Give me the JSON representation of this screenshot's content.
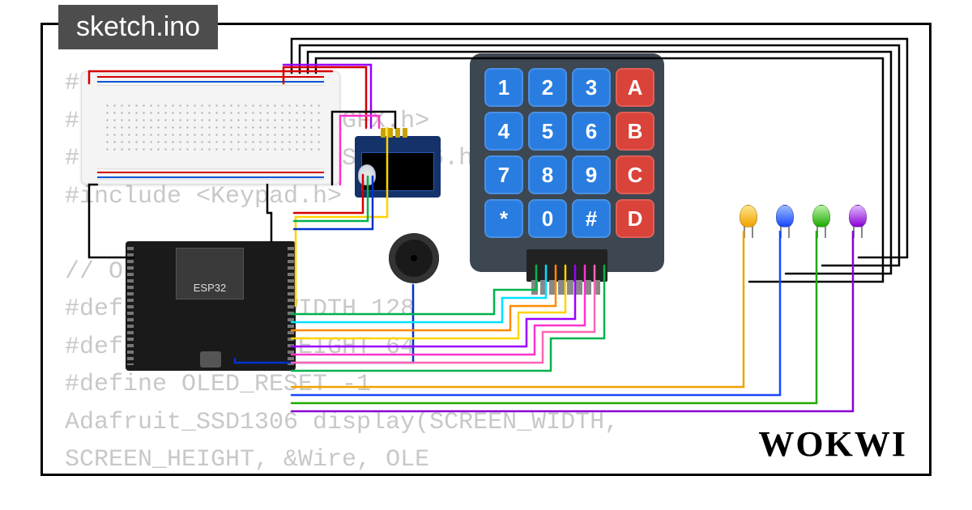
{
  "tab": {
    "filename": "sketch.ino"
  },
  "code_lines": [
    "#include <Wire.h>",
    "#include <Adafruit_GFX.h>",
    "#include <Adafruit_SSD1306.h>",
    "#include <Keypad.h>",
    "",
    "// OLED Display",
    "#define SCREEN_WIDTH 128",
    "#define SCREEN_HEIGHT 64",
    "#define OLED_RESET    -1",
    "Adafruit_SSD1306 display(SCREEN_WIDTH, SCREEN_HEIGHT, &Wire, OLE"
  ],
  "components": {
    "microcontroller": "ESP32",
    "oled_model": "SSD1306",
    "keypad_keys": [
      {
        "label": "1",
        "color": "blue"
      },
      {
        "label": "2",
        "color": "blue"
      },
      {
        "label": "3",
        "color": "blue"
      },
      {
        "label": "A",
        "color": "red"
      },
      {
        "label": "4",
        "color": "blue"
      },
      {
        "label": "5",
        "color": "blue"
      },
      {
        "label": "6",
        "color": "blue"
      },
      {
        "label": "B",
        "color": "red"
      },
      {
        "label": "7",
        "color": "blue"
      },
      {
        "label": "8",
        "color": "blue"
      },
      {
        "label": "9",
        "color": "blue"
      },
      {
        "label": "C",
        "color": "red"
      },
      {
        "label": "*",
        "color": "blue"
      },
      {
        "label": "0",
        "color": "blue"
      },
      {
        "label": "#",
        "color": "blue"
      },
      {
        "label": "D",
        "color": "red"
      }
    ],
    "leds": [
      {
        "name": "led-1",
        "color": "#f0a200"
      },
      {
        "name": "led-2",
        "color": "#1747ff"
      },
      {
        "name": "led-3",
        "color": "#1faa00"
      },
      {
        "name": "led-4",
        "color": "#8a00d4"
      }
    ],
    "buzzer_present": true,
    "rgb_led_present": true,
    "breadboard_present": true
  },
  "wire_colors": {
    "power_pos": "#d40000",
    "power_gnd": "#000000",
    "signal_green": "#00b34d",
    "signal_cyan": "#00e0ff",
    "signal_orange": "#ff8a00",
    "signal_yellow": "#ffd300",
    "signal_purple": "#9b00ff",
    "signal_magenta": "#ff33cc",
    "signal_blue": "#0033cc",
    "signal_pink": "#ff66b3"
  },
  "branding": {
    "logo_text": "WOKWI"
  }
}
